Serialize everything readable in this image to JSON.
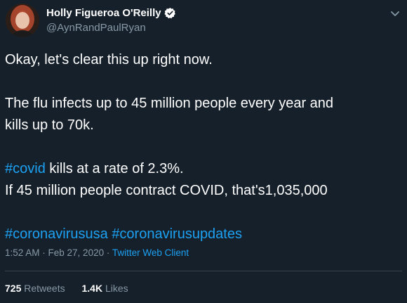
{
  "user": {
    "display_name": "Holly Figueroa O'Reilly",
    "handle": "@AynRandPaulRyan",
    "verified": true,
    "avatar": "avatar-photo-icon"
  },
  "tweet": {
    "line1": "Okay, let's clear this up right now.",
    "line2": "The flu infects up to 45 million people every year and",
    "line3": "kills up to 70k.",
    "line4_hashtag": "#covid",
    "line4_rest": " kills at a rate of 2.3%.",
    "line5": "If 45 million people contract COVID, that's1,035,000",
    "hashtag1": "#coronavirususa",
    "hashtag2": "#coronavirusupdates"
  },
  "meta": {
    "time": "1:52 AM",
    "sep1": " · ",
    "date": "Feb 27, 2020",
    "sep2": " · ",
    "client": "Twitter Web Client"
  },
  "stats": {
    "retweets_count": "725",
    "retweets_label": "Retweets",
    "likes_count": "1.4K",
    "likes_label": "Likes"
  },
  "colors": {
    "background": "#15202b",
    "text": "#ffffff",
    "secondary": "#8899a6",
    "accent": "#1da1f2"
  }
}
